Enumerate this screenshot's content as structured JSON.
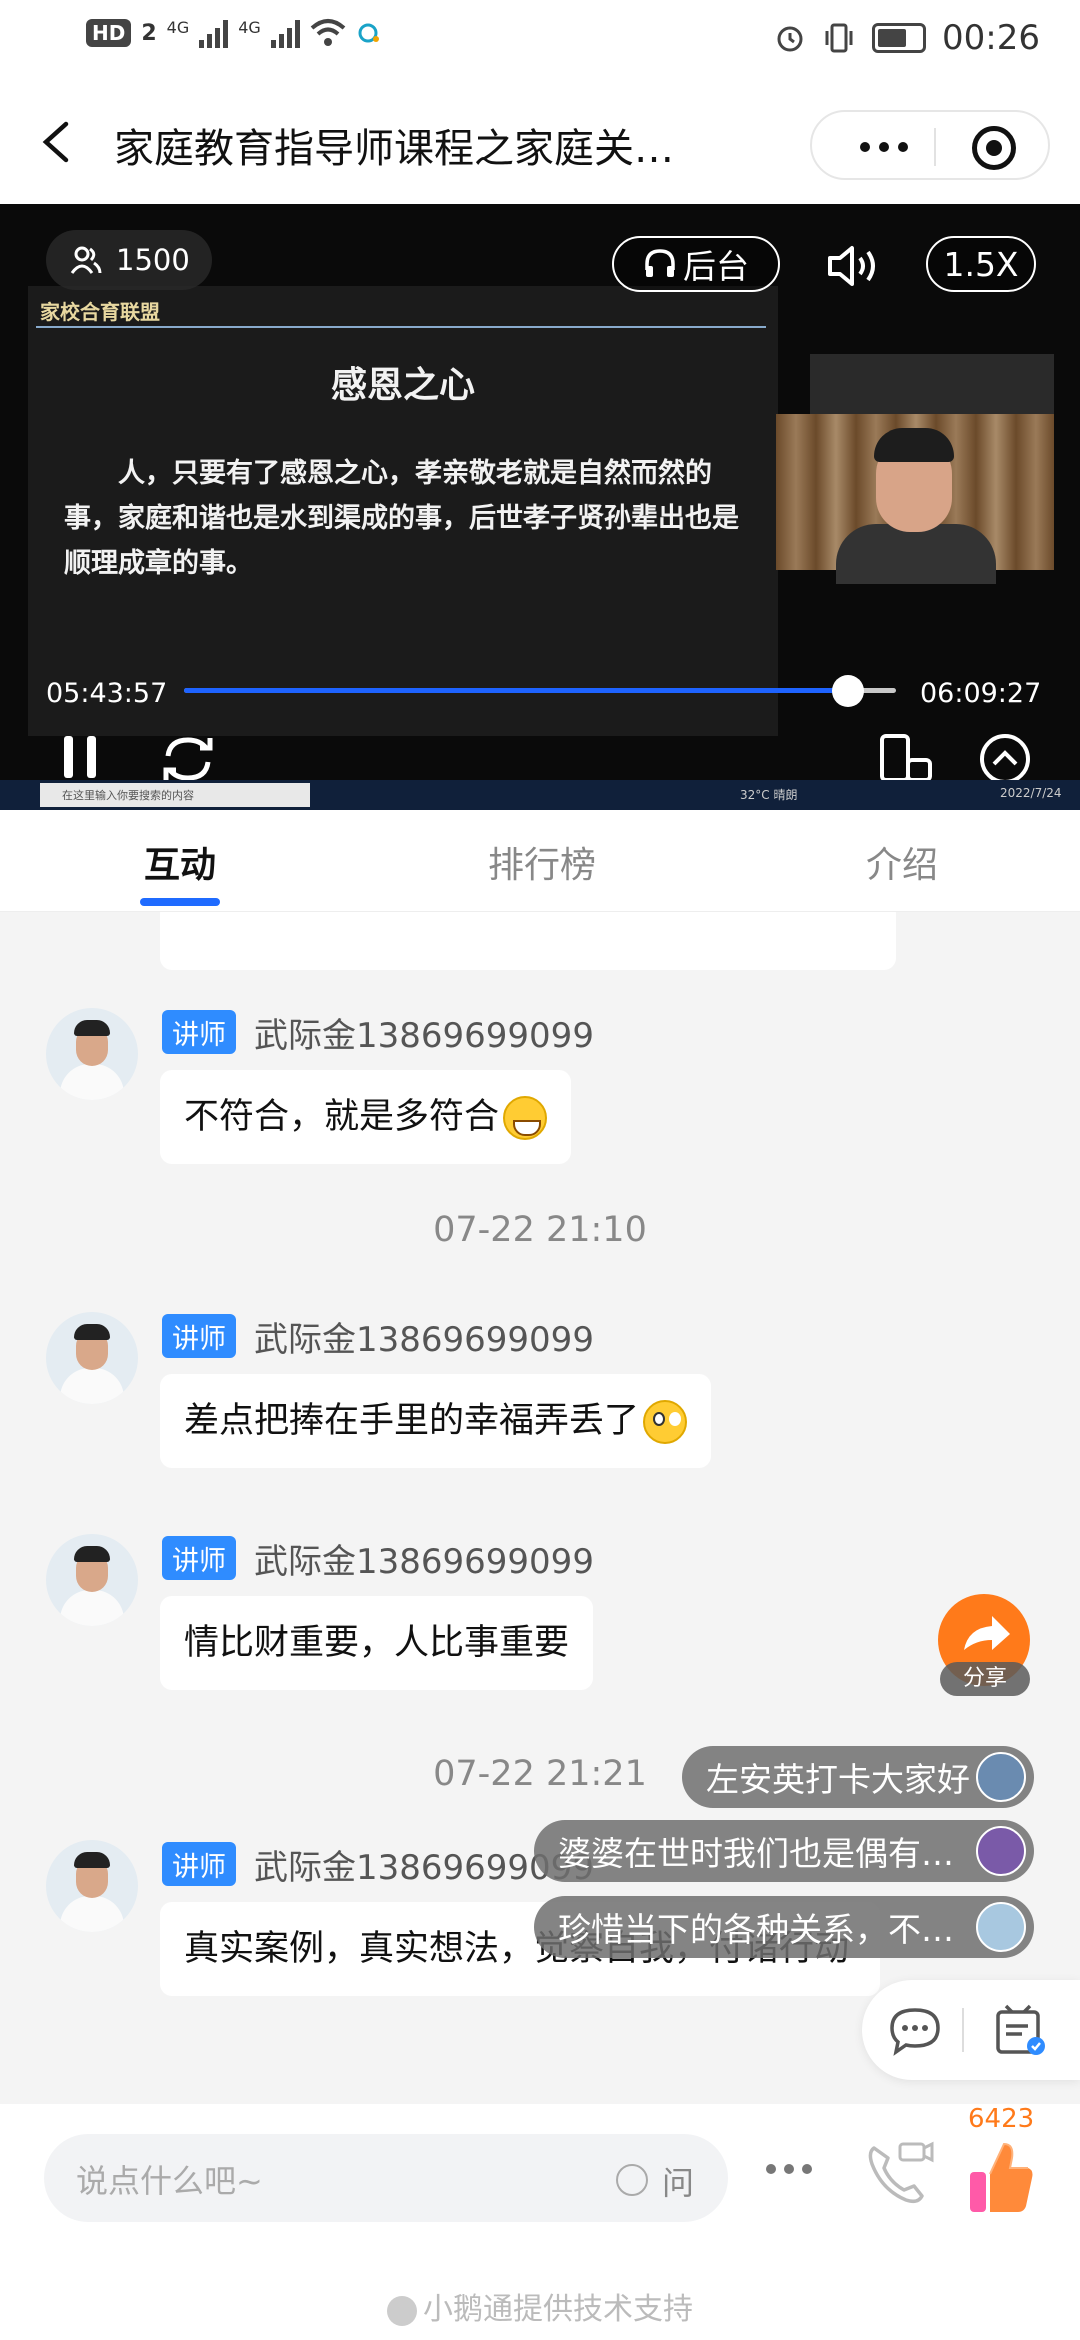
{
  "status_bar": {
    "network_badge": "HD",
    "sim_slot": "2",
    "net_type_1": "4G",
    "net_type_2": "4G",
    "time": "00:26"
  },
  "header": {
    "title": "家庭教育指导师课程之家庭关…"
  },
  "video": {
    "viewer_count": "1500",
    "background_label": "后台",
    "speed_label": "1.5X",
    "current_time": "05:43:57",
    "total_time": "06:09:27",
    "progress": 0.932,
    "slide": {
      "logo_text": "家校合育联盟",
      "title": "感恩之心",
      "body": "人，只要有了感恩之心，孝亲敬老就是自然而然的事，家庭和谐也是水到渠成的事，后世孝子贤孙辈出也是顺理成章的事。"
    },
    "taskbar": {
      "search_placeholder": "在这里输入你要搜索的内容",
      "weather": "32°C 晴朗",
      "date": "2022/7/24"
    }
  },
  "tabs": [
    {
      "label": "互动",
      "active": true
    },
    {
      "label": "排行榜",
      "active": false
    },
    {
      "label": "介绍",
      "active": false
    }
  ],
  "messages": [
    {
      "badge": "讲师",
      "user": "武际金13869699099",
      "text": "不符合，就是多符合",
      "emoji": "grin"
    },
    {
      "badge": "讲师",
      "user": "武际金13869699099",
      "text": "差点把捧在手里的幸福弄丢了",
      "emoji": "flushed"
    },
    {
      "badge": "讲师",
      "user": "武际金13869699099",
      "text": "情比财重要，人比事重要"
    },
    {
      "badge": "讲师",
      "user": "武际金13869699099",
      "text": "真实案例，真实想法，觉察自我，付诸行动"
    }
  ],
  "time_separators": [
    "07-22 21:10",
    "07-22 21:21"
  ],
  "danmaku": [
    "左安英打卡大家好",
    "婆婆在世时我们也是偶有…",
    "珍惜当下的各种关系，不…"
  ],
  "share_label": "分享",
  "input": {
    "placeholder": "说点什么吧~",
    "ask_label": "问"
  },
  "like_count": "6423",
  "footer": "小鹅通提供技术支持",
  "colors": {
    "accent": "#1f6bff",
    "badge": "#2f8cff",
    "share": "#ff7a1a"
  }
}
